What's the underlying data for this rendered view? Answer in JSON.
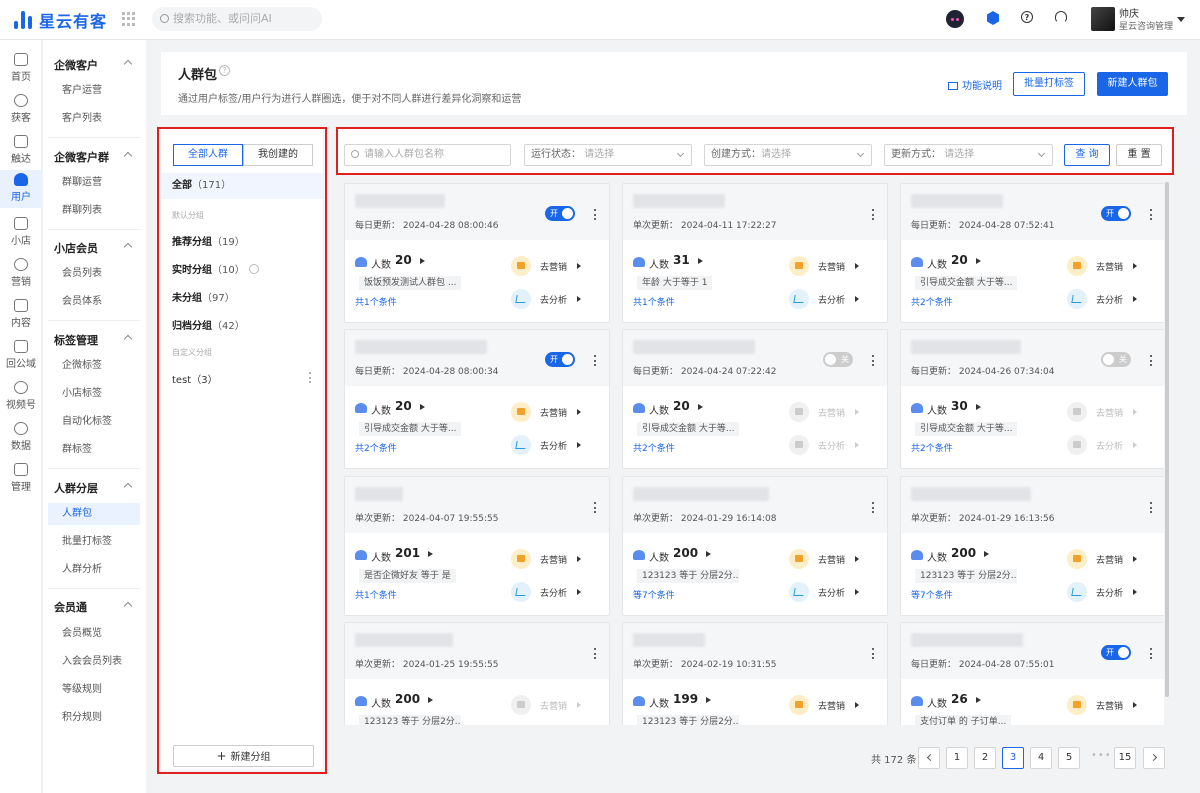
{
  "app": {
    "brand": "星云有客",
    "search_placeholder": "搜索功能、或问问AI"
  },
  "user": {
    "name": "帅庆",
    "org": "星云咨询管理"
  },
  "rail": [
    {
      "label": "首页",
      "icon": "home-icon"
    },
    {
      "label": "获客",
      "icon": "acquire-icon"
    },
    {
      "label": "触达",
      "icon": "reach-icon"
    },
    {
      "label": "用户",
      "icon": "user-icon",
      "active": true
    },
    {
      "label": "小店",
      "icon": "shop-icon"
    },
    {
      "label": "营销",
      "icon": "marketing-icon"
    },
    {
      "label": "内容",
      "icon": "content-icon"
    },
    {
      "label": "回公域",
      "icon": "public-domain-icon"
    },
    {
      "label": "视频号",
      "icon": "video-icon"
    },
    {
      "label": "数据",
      "icon": "data-icon"
    },
    {
      "label": "管理",
      "icon": "manage-icon"
    }
  ],
  "subnav": {
    "groups": [
      {
        "title": "企微客户",
        "items": [
          "客户运营",
          "客户列表"
        ]
      },
      {
        "title": "企微客户群",
        "items": [
          "群聊运营",
          "群聊列表"
        ]
      },
      {
        "title": "小店会员",
        "items": [
          "会员列表",
          "会员体系"
        ]
      },
      {
        "title": "标签管理",
        "items": [
          "企微标签",
          "小店标签",
          "自动化标签",
          "群标签"
        ]
      },
      {
        "title": "人群分层",
        "items": [
          "人群包",
          "批量打标签",
          "人群分析"
        ]
      },
      {
        "title": "会员通",
        "items": [
          "会员概览",
          "入会会员列表",
          "等级规则",
          "积分规则"
        ]
      }
    ]
  },
  "header": {
    "title": "人群包",
    "desc": "通过用户标签/用户行为进行人群圈选，便于对不同人群进行差异化洞察和运营",
    "help": "功能说明",
    "batch_btn": "批量打标签",
    "new_btn": "新建人群包"
  },
  "groups_panel": {
    "tabs": [
      "全部人群",
      "我创建的"
    ],
    "all_label": "全部",
    "all_count": "（171）",
    "default_label": "默认分组",
    "default_groups": [
      {
        "name": "推荐分组",
        "count": "（19）"
      },
      {
        "name": "实时分组",
        "count": "（10）"
      },
      {
        "name": "未分组",
        "count": "（97）"
      },
      {
        "name": "归档分组",
        "count": "（42）"
      }
    ],
    "custom_label": "自定义分组",
    "custom_groups": [
      {
        "name": "test",
        "count": "（3）"
      }
    ],
    "new_group": "新建分组"
  },
  "filter": {
    "name_placeholder": "请输入人群包名称",
    "run_status_label": "运行状态：",
    "create_method_label": "创建方式：",
    "update_method_label": "更新方式：",
    "select_placeholder": "请选择",
    "query": "查 询",
    "reset": "重 置"
  },
  "card_common": {
    "people_label": "人数",
    "marketing": "去营销",
    "analysis": "去分析"
  },
  "cards": [
    {
      "update": "每日更新：  2024-04-28 08:00:46",
      "toggle": "开",
      "count": "20",
      "condition": "饭饭预发测试人群包 ...",
      "conditions_count": "共1个条件",
      "enabled": true
    },
    {
      "update": "单次更新：  2024-04-11 17:22:27",
      "toggle": "",
      "count": "31",
      "condition": "年龄 大于等于 1",
      "conditions_count": "共1个条件",
      "enabled": true
    },
    {
      "update": "每日更新：  2024-04-28 07:52:41",
      "toggle": "开",
      "count": "20",
      "condition": "引导成交金额 大于等...",
      "conditions_count": "共2个条件",
      "enabled": true
    },
    {
      "update": "每日更新：  2024-04-28 08:00:34",
      "toggle": "开",
      "count": "20",
      "condition": "引导成交金额 大于等...",
      "conditions_count": "共2个条件",
      "enabled": true
    },
    {
      "update": "每日更新：  2024-04-24 07:22:42",
      "toggle": "关",
      "count": "20",
      "condition": "引导成交金额 大于等...",
      "conditions_count": "共2个条件",
      "enabled": false
    },
    {
      "update": "每日更新：  2024-04-26 07:34:04",
      "toggle": "关",
      "count": "30",
      "condition": "引导成交金额 大于等...",
      "conditions_count": "共2个条件",
      "enabled": false
    },
    {
      "update": "单次更新：  2024-04-07 19:55:55",
      "toggle": "",
      "count": "201",
      "condition": "是否企微好友 等于 是",
      "conditions_count": "共1个条件",
      "enabled": true
    },
    {
      "update": "单次更新：  2024-01-29 16:14:08",
      "toggle": "",
      "count": "200",
      "condition": "123123 等于 分层2分...",
      "conditions_count": "等7个条件",
      "enabled": true
    },
    {
      "update": "单次更新：  2024-01-29 16:13:56",
      "toggle": "",
      "count": "200",
      "condition": "123123 等于 分层2分...",
      "conditions_count": "等7个条件",
      "enabled": true
    },
    {
      "update": "单次更新：  2024-01-25 19:55:55",
      "toggle": "",
      "count": "200",
      "condition": "123123 等于 分层2分...",
      "conditions_count": "",
      "enabled": false
    },
    {
      "update": "单次更新：  2024-02-19 10:31:55",
      "toggle": "",
      "count": "199",
      "condition": "123123 等于 分层2分...",
      "conditions_count": "",
      "enabled": true
    },
    {
      "update": "每日更新：  2024-04-28 07:55:01",
      "toggle": "开",
      "count": "26",
      "condition": "支付订单 的 子订单...",
      "conditions_count": "",
      "enabled": true
    }
  ],
  "pagination": {
    "total": "共 172 条",
    "pages": [
      "1",
      "2",
      "3",
      "4",
      "5"
    ],
    "current": "3",
    "ellipsis": "•••",
    "last": "15"
  },
  "colors": {
    "primary": "#1a66e8",
    "highlight_border": "#e02020"
  }
}
